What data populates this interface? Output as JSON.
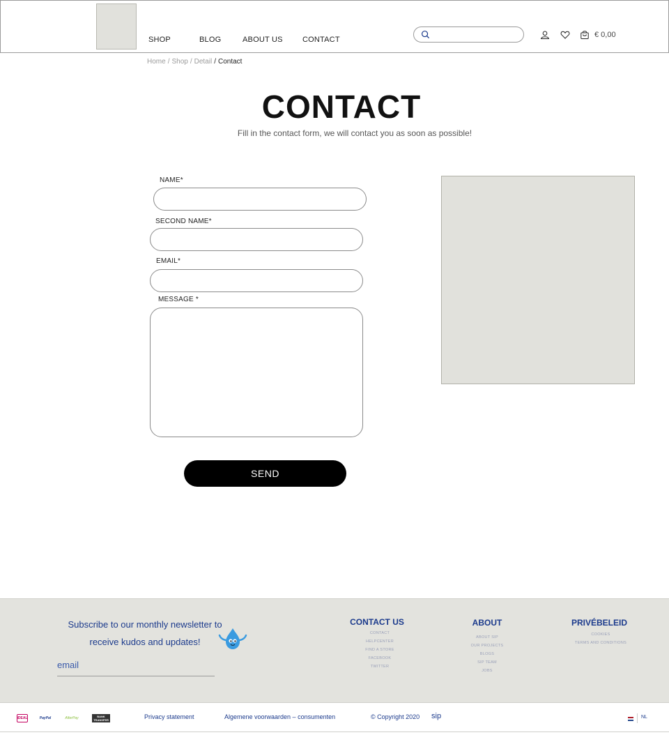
{
  "header": {
    "nav": [
      "SHOP",
      "BLOG",
      "ABOUT US",
      "CONTACT"
    ],
    "search_placeholder": "",
    "cart_total": "€ 0,00"
  },
  "breadcrumb": {
    "items": [
      "Home",
      "Shop",
      "Detail"
    ],
    "current": "Contact"
  },
  "page": {
    "title": "CONTACT",
    "subtitle": "Fill in the contact form, we will contact you as soon as possible!"
  },
  "form": {
    "name_label": "NAME*",
    "second_name_label": "SECOND NAME*",
    "email_label": "EMAIL*",
    "message_label": "MESSAGE *",
    "send_label": "SEND"
  },
  "footer": {
    "newsletter_text": "Subscribe to our monthly newsletter to receive kudos and updates!",
    "email_placeholder": "email",
    "columns": [
      {
        "title": "CONTACT US",
        "links": [
          "CONTACT",
          "HELPCENTER",
          "FIND A STORE",
          "FACEBOOK",
          "TWITTER"
        ]
      },
      {
        "title": "ABOUT",
        "links": [
          "ABOUT SIP",
          "OUR PROJECTS",
          "BLOGS",
          "SIP TEAM",
          "JOBS"
        ]
      },
      {
        "title": "PRIVÉBELEID",
        "links": [
          "COOKIES",
          "TERMS AND CONDITIONS"
        ]
      }
    ],
    "payment_logos": [
      "iDEAL",
      "PayPal",
      "AfterPay",
      "BANK TRANSFER"
    ],
    "privacy_label": "Privacy statement",
    "terms_label": "Algemene voorwaarden – consumenten",
    "copyright": "© Copyright 2020",
    "brand": "sip",
    "language": "NL"
  },
  "colors": {
    "accent_blue": "#1b3a8c",
    "footer_bg": "#e3e3de",
    "placeholder_gray": "#e1e1dc"
  }
}
